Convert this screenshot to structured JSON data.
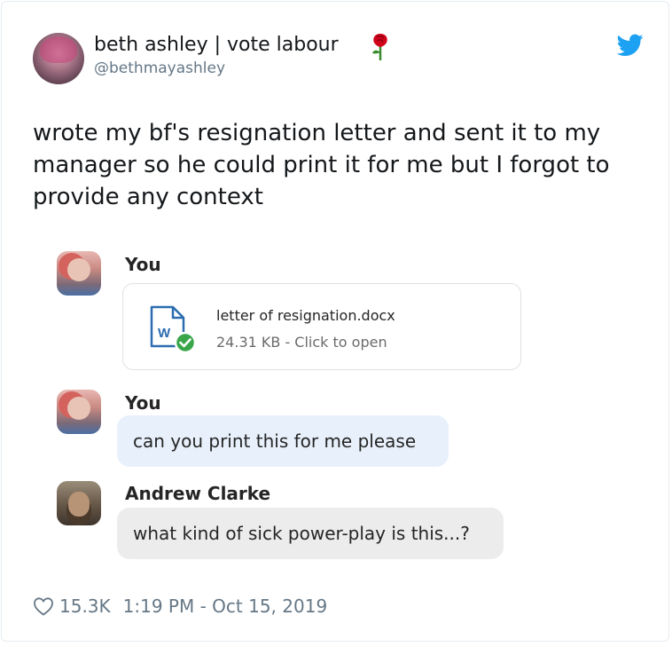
{
  "tweet": {
    "display_name": "beth ashley | vote labour",
    "handle": "@bethmayashley",
    "text": "wrote my bf's resignation letter and sent it to my manager so he could print it for me but I forgot to provide any context",
    "likes": "15.3K",
    "timestamp": "1:19 PM - Oct 15, 2019"
  },
  "chat": {
    "messages": [
      {
        "sender": "You",
        "file": {
          "name": "letter of resignation.docx",
          "meta": "24.31 KB - Click to open",
          "icon": "word-doc-icon"
        }
      },
      {
        "sender": "You",
        "text": "can you print this for me please"
      },
      {
        "sender": "Andrew Clarke",
        "text": "what kind of sick power-play is this...?"
      }
    ]
  },
  "icons": {
    "rose": "rose-icon",
    "twitter": "twitter-bird-icon",
    "heart": "heart-icon"
  },
  "colors": {
    "twitter_blue": "#1da1f2",
    "rose_red": "#d0021b",
    "check_green": "#3aa64a",
    "word_blue": "#2b6cb0",
    "bubble_blue": "#e8f1fb",
    "bubble_grey": "#ececec"
  }
}
